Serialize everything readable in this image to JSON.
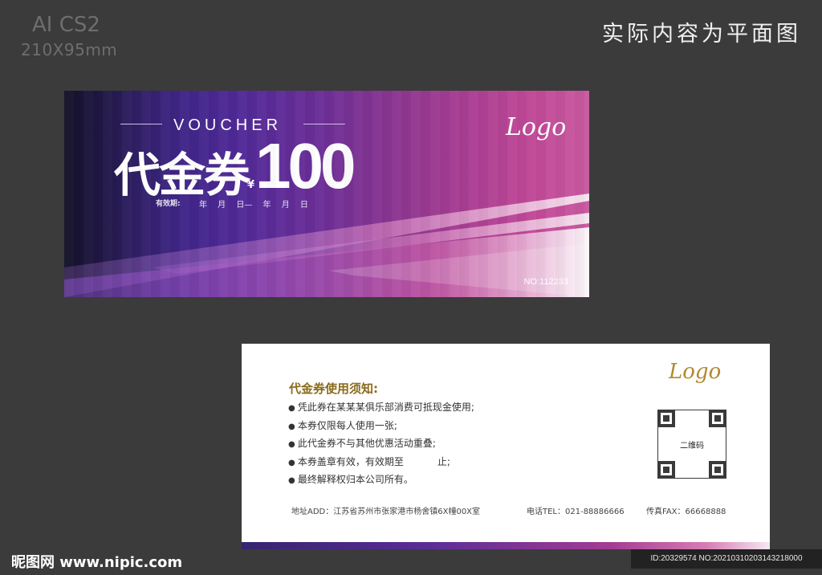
{
  "header": {
    "software": "AI CS2",
    "dimensions": "210X95mm",
    "note": "实际内容为平面图"
  },
  "front": {
    "voucher_word": "VOUCHER",
    "title": "代金券",
    "currency": "¥",
    "amount": "100",
    "validity_label": "有效期:",
    "date_range": "年 月 日— 年 月 日",
    "logo": "Logo",
    "serial": "NO:112233"
  },
  "back": {
    "notice_title": "代金券使用须知:",
    "rules": [
      "凭此券在某某某俱乐部消费可抵现金使用;",
      "本券仅限每人使用一张;",
      "此代金券不与其他优惠活动重叠;",
      "本券盖章有效，有效期至           止;",
      "最终解释权归本公司所有。"
    ],
    "logo": "Logo",
    "qr_label": "二维码",
    "address": "地址ADD：江苏省苏州市张家港市杨舍镇6X幢00X室",
    "phone": "电话TEL：021-88886666",
    "fax": "传真FAX：66668888"
  },
  "footer": {
    "site": "昵图网 www.nipic.com",
    "image_id": "ID:20329574 NO:20210310203143218000"
  },
  "colors": {
    "background": "#3b3b3b",
    "front_dark": "#141129",
    "front_purple": "#522a98",
    "front_pink": "#c24a98",
    "notice_gold": "#8a6a1b",
    "logo_gold": "#b18a2f"
  },
  "icons": [
    "qr-code-icon",
    "bullet-icon"
  ]
}
